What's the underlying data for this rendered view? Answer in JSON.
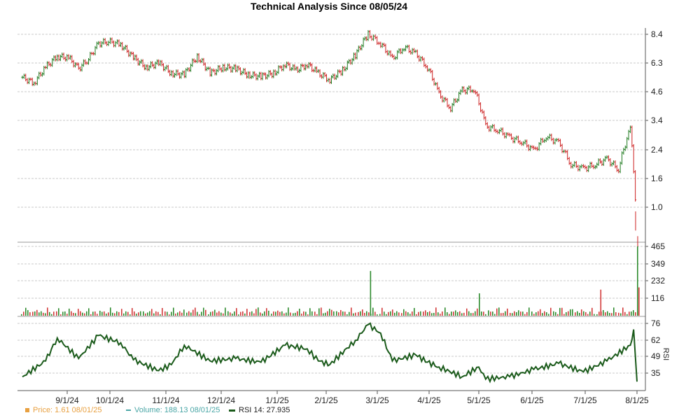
{
  "chart_data": {
    "type": "ohlc",
    "title": "Technical Analysis Since 08/05/24",
    "x_ticks": [
      "9/1/24",
      "10/1/24",
      "11/1/24",
      "12/1/24",
      "1/1/25",
      "2/1/25",
      "3/1/25",
      "4/1/25",
      "5/1/25",
      "6/1/25",
      "7/1/25",
      "8/1/25"
    ],
    "price_axis": {
      "ticks": [
        "8.4",
        "6.3",
        "4.6",
        "3.4",
        "2.4",
        "1.6",
        "1.0"
      ],
      "scale": "log"
    },
    "volume_axis": {
      "ticks": [
        "465",
        "349",
        "232",
        "116"
      ]
    },
    "rsi_axis": {
      "ticks": [
        "76",
        "62",
        "49",
        "35"
      ],
      "label": "RSI"
    },
    "price_series": [
      {
        "date": "2024-08-05",
        "close": 4.95
      },
      {
        "date": "2024-08-12",
        "close": 4.6
      },
      {
        "date": "2024-08-19",
        "close": 5.6
      },
      {
        "date": "2024-08-26",
        "close": 6.4
      },
      {
        "date": "2024-09-02",
        "close": 6.3
      },
      {
        "date": "2024-09-09",
        "close": 5.5
      },
      {
        "date": "2024-09-16",
        "close": 6.2
      },
      {
        "date": "2024-09-23",
        "close": 7.5
      },
      {
        "date": "2024-09-30",
        "close": 7.7
      },
      {
        "date": "2024-10-07",
        "close": 7.4
      },
      {
        "date": "2024-10-14",
        "close": 6.3
      },
      {
        "date": "2024-10-21",
        "close": 5.6
      },
      {
        "date": "2024-10-28",
        "close": 5.9
      },
      {
        "date": "2024-11-04",
        "close": 5.2
      },
      {
        "date": "2024-11-11",
        "close": 5.1
      },
      {
        "date": "2024-11-18",
        "close": 6.4
      },
      {
        "date": "2024-11-25",
        "close": 5.2
      },
      {
        "date": "2024-12-02",
        "close": 5.6
      },
      {
        "date": "2024-12-09",
        "close": 5.5
      },
      {
        "date": "2024-12-16",
        "close": 5.1
      },
      {
        "date": "2024-12-23",
        "close": 5.0
      },
      {
        "date": "2024-12-30",
        "close": 5.2
      },
      {
        "date": "2025-01-06",
        "close": 5.8
      },
      {
        "date": "2025-01-13",
        "close": 5.4
      },
      {
        "date": "2025-01-20",
        "close": 5.8
      },
      {
        "date": "2025-01-27",
        "close": 5.2
      },
      {
        "date": "2025-02-03",
        "close": 4.8
      },
      {
        "date": "2025-02-10",
        "close": 5.4
      },
      {
        "date": "2025-02-17",
        "close": 6.5
      },
      {
        "date": "2025-02-24",
        "close": 8.4
      },
      {
        "date": "2025-03-03",
        "close": 7.5
      },
      {
        "date": "2025-03-10",
        "close": 6.2
      },
      {
        "date": "2025-03-17",
        "close": 7.2
      },
      {
        "date": "2025-03-24",
        "close": 6.6
      },
      {
        "date": "2025-03-31",
        "close": 5.6
      },
      {
        "date": "2025-04-07",
        "close": 4.0
      },
      {
        "date": "2025-04-14",
        "close": 3.4
      },
      {
        "date": "2025-04-21",
        "close": 4.2
      },
      {
        "date": "2025-04-28",
        "close": 4.3
      },
      {
        "date": "2025-05-05",
        "close": 2.7
      },
      {
        "date": "2025-05-12",
        "close": 2.6
      },
      {
        "date": "2025-05-19",
        "close": 2.35
      },
      {
        "date": "2025-05-26",
        "close": 2.25
      },
      {
        "date": "2025-06-02",
        "close": 2.0
      },
      {
        "date": "2025-06-09",
        "close": 2.4
      },
      {
        "date": "2025-06-16",
        "close": 2.2
      },
      {
        "date": "2025-06-23",
        "close": 1.7
      },
      {
        "date": "2025-06-30",
        "close": 1.6
      },
      {
        "date": "2025-07-07",
        "close": 1.7
      },
      {
        "date": "2025-07-14",
        "close": 1.8
      },
      {
        "date": "2025-07-21",
        "close": 1.6
      },
      {
        "date": "2025-07-28",
        "close": 2.6
      },
      {
        "date": "2025-08-01",
        "close": 0.6
      }
    ],
    "volume_series_note": "mostly small bars (~10-40), spikes ~300 near 2/25, ~460 on 8/1/25",
    "volume_spikes": [
      {
        "date": "2025-02-25",
        "value": 300
      },
      {
        "date": "2025-05-01",
        "value": 150
      },
      {
        "date": "2025-07-10",
        "value": 175
      },
      {
        "date": "2025-08-01",
        "value": 465
      },
      {
        "date": "2025-08-01b",
        "value": 190
      }
    ],
    "rsi_series": [
      {
        "date": "2024-08-05",
        "value": 32
      },
      {
        "date": "2024-08-19",
        "value": 45
      },
      {
        "date": "2024-08-26",
        "value": 64
      },
      {
        "date": "2024-09-09",
        "value": 47
      },
      {
        "date": "2024-09-23",
        "value": 66
      },
      {
        "date": "2024-10-07",
        "value": 60
      },
      {
        "date": "2024-10-14",
        "value": 46
      },
      {
        "date": "2024-10-28",
        "value": 37
      },
      {
        "date": "2024-11-04",
        "value": 42
      },
      {
        "date": "2024-11-11",
        "value": 58
      },
      {
        "date": "2024-11-25",
        "value": 45
      },
      {
        "date": "2024-12-09",
        "value": 47
      },
      {
        "date": "2024-12-23",
        "value": 44
      },
      {
        "date": "2025-01-06",
        "value": 58
      },
      {
        "date": "2025-01-20",
        "value": 55
      },
      {
        "date": "2025-01-27",
        "value": 45
      },
      {
        "date": "2025-02-03",
        "value": 42
      },
      {
        "date": "2025-02-17",
        "value": 62
      },
      {
        "date": "2025-02-24",
        "value": 75
      },
      {
        "date": "2025-03-03",
        "value": 68
      },
      {
        "date": "2025-03-10",
        "value": 45
      },
      {
        "date": "2025-03-24",
        "value": 50
      },
      {
        "date": "2025-03-31",
        "value": 44
      },
      {
        "date": "2025-04-07",
        "value": 40
      },
      {
        "date": "2025-04-21",
        "value": 32
      },
      {
        "date": "2025-05-01",
        "value": 40
      },
      {
        "date": "2025-05-05",
        "value": 30
      },
      {
        "date": "2025-05-19",
        "value": 32
      },
      {
        "date": "2025-06-02",
        "value": 38
      },
      {
        "date": "2025-06-16",
        "value": 43
      },
      {
        "date": "2025-06-30",
        "value": 36
      },
      {
        "date": "2025-07-14",
        "value": 45
      },
      {
        "date": "2025-07-28",
        "value": 58
      },
      {
        "date": "2025-07-30",
        "value": 71
      },
      {
        "date": "2025-08-01",
        "value": 27.935
      }
    ],
    "legend": {
      "price": "Price: 1.61  08/01/25",
      "volume": "Volume: 188.13  08/01/25",
      "rsi": "RSI 14: 27.935"
    }
  }
}
